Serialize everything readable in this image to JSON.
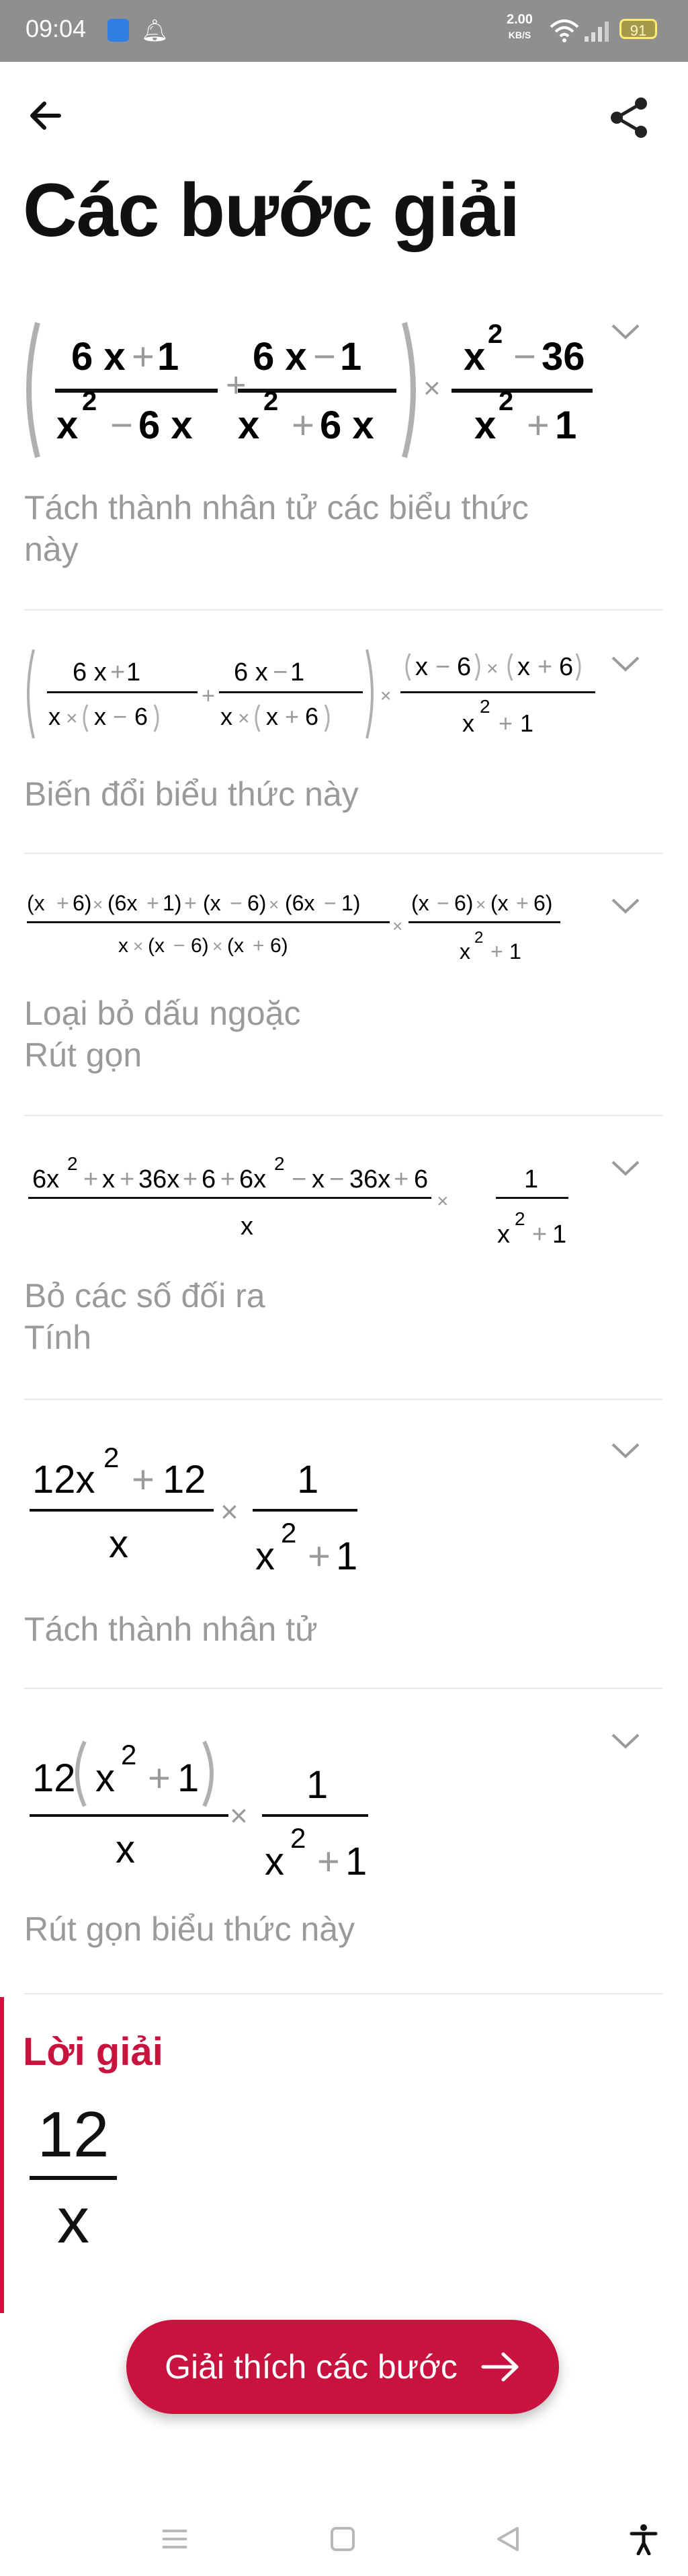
{
  "status_bar": {
    "time": "09:04",
    "speed_value": "2.00",
    "speed_unit": "KB/S",
    "battery": "91"
  },
  "header": {
    "title": "Các bước giải"
  },
  "steps": [
    {
      "caption_lines": [
        "Tách thành nhân tử các biểu thức",
        "này"
      ]
    },
    {
      "caption_lines": [
        "Biến đổi biểu thức này"
      ]
    },
    {
      "caption_lines": [
        "Loại bỏ dấu ngoặc",
        "Rút gọn"
      ]
    },
    {
      "caption_lines": [
        "Bỏ các số đối ra",
        "Tính"
      ]
    },
    {
      "caption_lines": [
        "Tách thành nhân tử"
      ]
    },
    {
      "caption_lines": [
        "Rút gọn biểu thức này"
      ]
    }
  ],
  "result": {
    "title": "Lời giải",
    "numerator": "12",
    "denominator": "x"
  },
  "explain_button": {
    "label": "Giải thích các bước"
  },
  "colors": {
    "accent": "#c8133f",
    "caption": "#9a9a9a",
    "status_bar": "#8f8f8f"
  }
}
